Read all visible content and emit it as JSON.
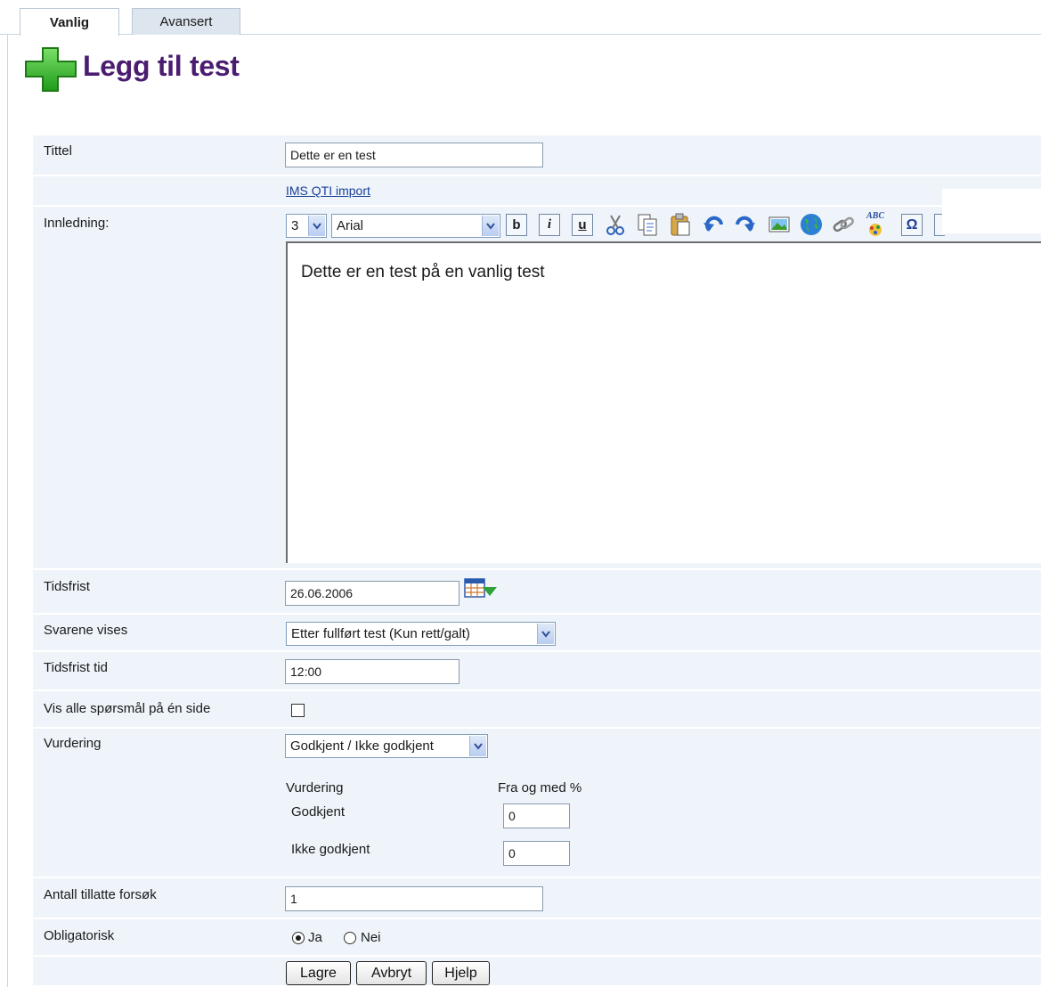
{
  "tabs": [
    {
      "label": "Vanlig",
      "active": true
    },
    {
      "label": "Avansert",
      "active": false
    }
  ],
  "header": {
    "title": "Legg til test",
    "icon": "plus-icon"
  },
  "form": {
    "tittel": {
      "label": "Tittel",
      "value": "Dette er en test"
    },
    "import_link": "IMS QTI import",
    "innledning": {
      "label": "Innledning:",
      "font_size": "3",
      "font_family": "Arial",
      "toolbar": [
        "bold-icon",
        "italic-icon",
        "underline-icon",
        "cut-icon",
        "copy-icon",
        "paste-icon",
        "undo-icon",
        "redo-icon",
        "image-icon",
        "globe-icon",
        "link-icon",
        "spellcheck-icon",
        "special-char-icon"
      ],
      "bold": "b",
      "italic": "i",
      "underline": "u",
      "spell": "ABC",
      "omega": "Ω",
      "content": "Dette er en test på en vanlig test"
    },
    "tidsfrist": {
      "label": "Tidsfrist",
      "value": "26.06.2006"
    },
    "svarene": {
      "label": "Svarene vises",
      "value": "Etter fullført test (Kun rett/galt)"
    },
    "tidsfrist_tid": {
      "label": "Tidsfrist tid",
      "value": "12:00"
    },
    "vis_alle": {
      "label": "Vis alle spørsmål på én side",
      "checked": false
    },
    "vurdering": {
      "label": "Vurdering",
      "value": "Godkjent / Ikke godkjent",
      "col_header": "Vurdering",
      "col_percent": "Fra og med %",
      "rows": [
        {
          "label": "Godkjent",
          "value": "0"
        },
        {
          "label": "Ikke godkjent",
          "value": "0"
        }
      ]
    },
    "antall": {
      "label": "Antall tillatte forsøk",
      "value": "1"
    },
    "obligatorisk": {
      "label": "Obligatorisk",
      "yes": "Ja",
      "no": "Nei",
      "selected": "Ja"
    }
  },
  "buttons": {
    "save": "Lagre",
    "cancel": "Avbryt",
    "help": "Hjelp"
  },
  "colors": {
    "title": "#4b1d70",
    "row_bg": "#eef4fa",
    "plus": "#3cb72c",
    "link": "#1a3f9a"
  }
}
